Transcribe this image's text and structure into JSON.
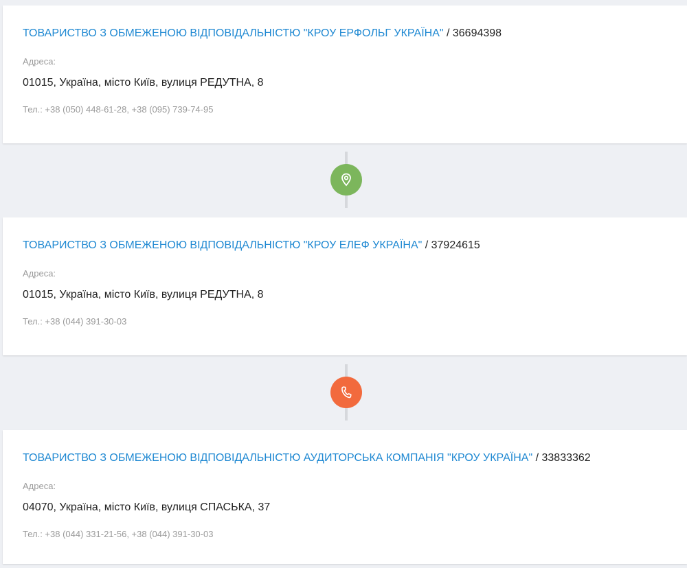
{
  "colors": {
    "link": "#1e88d2",
    "address_connector": "#7cb65c",
    "phone_connector": "#f26a3d",
    "background": "#eef0f4"
  },
  "companies": [
    {
      "name": "ТОВАРИСТВО З ОБМЕЖЕНОЮ ВІДПОВІДАЛЬНІСТЮ \"КРОУ ЕРФОЛЬГ УКРАЇНА\"",
      "code": " / 36694398",
      "address_label": "Адреса:",
      "address": "01015, Україна, місто Київ, вулиця РЕДУТНА, 8",
      "phones": "Тел.: +38 (050) 448-61-28, +38 (095) 739-74-95"
    },
    {
      "name": "ТОВАРИСТВО З ОБМЕЖЕНОЮ ВІДПОВІДАЛЬНІСТЮ \"КРОУ ЕЛЕФ УКРАЇНА\"",
      "code": " / 37924615",
      "address_label": "Адреса:",
      "address": "01015, Україна, місто Київ, вулиця РЕДУТНА, 8",
      "phones": "Тел.: +38 (044) 391-30-03"
    },
    {
      "name": "ТОВАРИСТВО З ОБМЕЖЕНОЮ ВІДПОВІДАЛЬНІСТЮ АУДИТОРСЬКА КОМПАНІЯ \"КРОУ УКРАЇНА\"",
      "code": " / 33833362",
      "address_label": "Адреса:",
      "address": "04070, Україна, місто Київ, вулиця СПАСЬКА, 37",
      "phones": "Тел.: +38 (044) 331-21-56, +38 (044) 391-30-03"
    }
  ],
  "connectors": [
    {
      "icon": "map-pin-icon",
      "meaning": "shared address"
    },
    {
      "icon": "phone-icon",
      "meaning": "shared phone"
    }
  ]
}
